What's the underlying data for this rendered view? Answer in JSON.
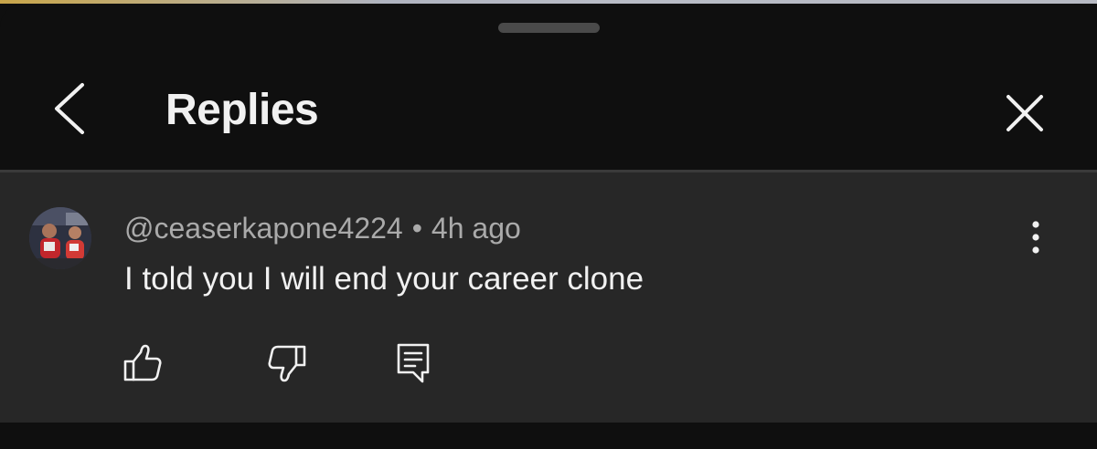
{
  "header": {
    "title": "Replies",
    "back_icon": "chevron-left-icon",
    "close_icon": "close-icon"
  },
  "comment": {
    "handle": "@ceaserkapone4224",
    "separator": "•",
    "time": "4h ago",
    "text": "I told you I will end your career clone",
    "actions": {
      "like_icon": "thumbs-up-icon",
      "dislike_icon": "thumbs-down-icon",
      "reply_icon": "reply-comment-icon",
      "more_icon": "vertical-ellipsis-icon"
    }
  },
  "colors": {
    "background": "#0f0f0f",
    "comment_background": "#272727",
    "text_primary": "#f1f1f1",
    "text_secondary": "#aaaaaa",
    "handle_bar": "#4a4a4a"
  }
}
